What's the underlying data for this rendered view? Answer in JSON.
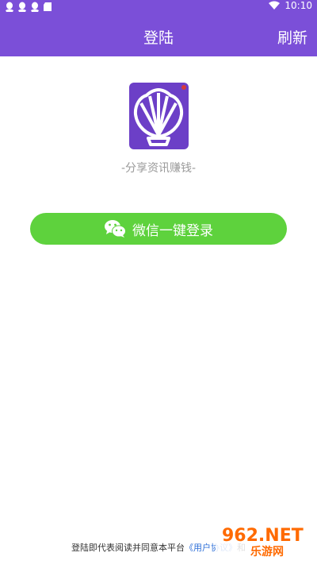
{
  "status_bar": {
    "time": "10:10"
  },
  "header": {
    "title": "登陆",
    "refresh_label": "刷新"
  },
  "main": {
    "slogan": "-分享资讯赚钱-",
    "login_button_label": "微信一键登录"
  },
  "footer": {
    "agreement_prefix": "登陆即代表阅读并同意本平台",
    "user_agreement_link": "《用户协议》",
    "conjunction": "和"
  },
  "watermark": {
    "brand": "962.NET",
    "subtitle": "乐游网"
  },
  "colors": {
    "primary": "#7b4fd8",
    "wechat_green": "#5ed23d",
    "link": "#2e6fd8",
    "watermark": "#ff6a00"
  },
  "icons": [
    "qq-icon",
    "qq-icon",
    "qq-icon",
    "sd-card-icon",
    "wifi-icon",
    "wechat-icon",
    "shell-logo-icon"
  ]
}
